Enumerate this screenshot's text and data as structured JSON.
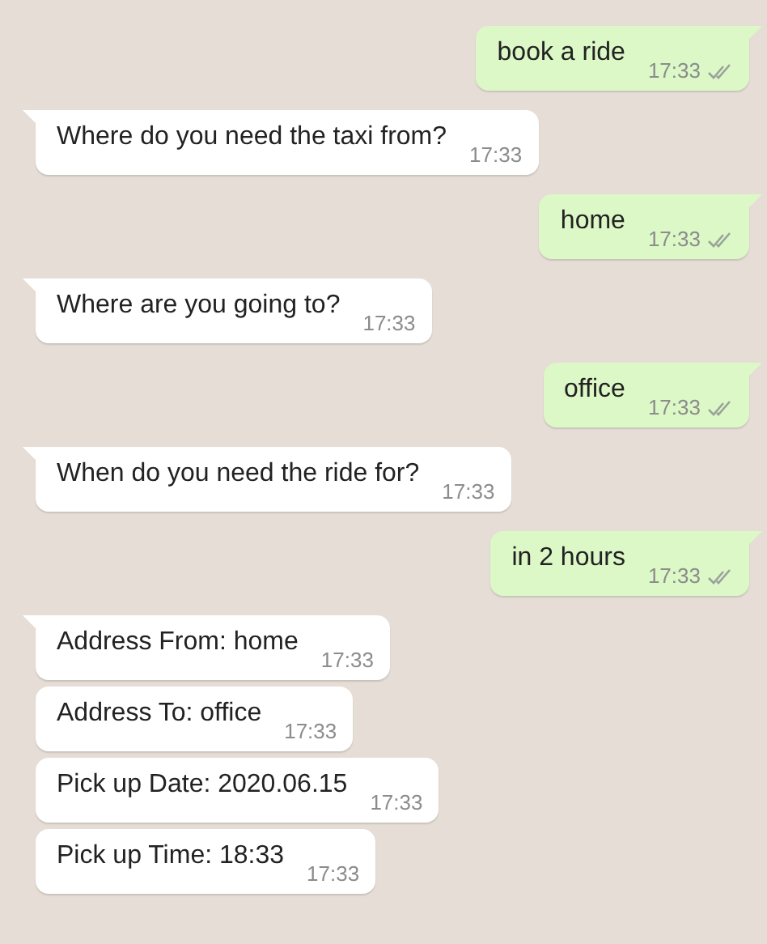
{
  "messages": [
    {
      "kind": "sent",
      "text": "book a ride",
      "time": "17:33",
      "delivered": true,
      "tail": true
    },
    {
      "kind": "received",
      "text": "Where do you need the taxi from?",
      "time": "17:33",
      "tail": true
    },
    {
      "kind": "sent",
      "text": "home",
      "time": "17:33",
      "delivered": true,
      "tail": true
    },
    {
      "kind": "received",
      "text": "Where are you going to?",
      "time": "17:33",
      "tail": true
    },
    {
      "kind": "sent",
      "text": "office",
      "time": "17:33",
      "delivered": true,
      "tail": true
    },
    {
      "kind": "received",
      "text": "When do you need the ride for?",
      "time": "17:33",
      "tail": true
    },
    {
      "kind": "sent",
      "text": "in 2 hours",
      "time": "17:33",
      "delivered": true,
      "tail": true
    },
    {
      "kind": "received",
      "text": "Address From: home",
      "time": "17:33",
      "tail": true
    },
    {
      "kind": "received",
      "text": "Address To: office",
      "time": "17:33",
      "tail": false
    },
    {
      "kind": "received",
      "text": "Pick up Date: 2020.06.15",
      "time": "17:33",
      "tail": false
    },
    {
      "kind": "received",
      "text": "Pick up Time: 18:33",
      "time": "17:33",
      "tail": false
    }
  ]
}
